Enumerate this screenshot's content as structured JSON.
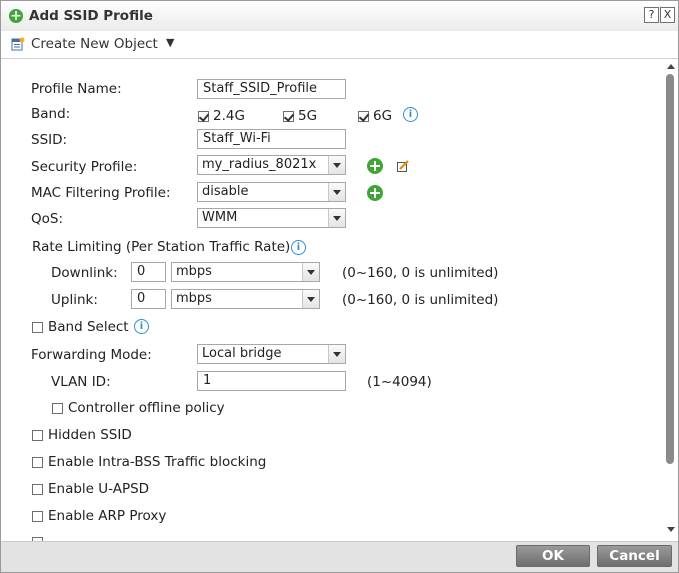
{
  "dialog": {
    "title": "Add SSID Profile",
    "help_label": "?",
    "close_label": "X"
  },
  "toolbar": {
    "create_label": "Create New Object",
    "caret": "▼"
  },
  "form": {
    "profile_name": {
      "label": "Profile Name:",
      "value": "Staff_SSID_Profile"
    },
    "band": {
      "label": "Band:",
      "options": [
        {
          "label": "2.4G",
          "checked": true
        },
        {
          "label": "5G",
          "checked": true
        },
        {
          "label": "6G",
          "checked": true
        }
      ]
    },
    "ssid": {
      "label": "SSID:",
      "value": "Staff_Wi-Fi"
    },
    "security_profile": {
      "label": "Security Profile:",
      "value": "my_radius_8021x"
    },
    "mac_filtering": {
      "label": "MAC Filtering Profile:",
      "value": "disable"
    },
    "qos": {
      "label": "QoS:",
      "value": "WMM"
    },
    "rate_limiting": {
      "label": "Rate Limiting (Per Station Traffic Rate)",
      "downlink": {
        "label": "Downlink:",
        "value": "0",
        "unit": "mbps",
        "hint": "(0~160, 0 is unlimited)"
      },
      "uplink": {
        "label": "Uplink:",
        "value": "0",
        "unit": "mbps",
        "hint": "(0~160, 0 is unlimited)"
      }
    },
    "band_select": {
      "label": "Band Select",
      "checked": false
    },
    "forwarding_mode": {
      "label": "Forwarding Mode:",
      "value": "Local bridge"
    },
    "vlan_id": {
      "label": "VLAN ID:",
      "value": "1",
      "hint": "(1~4094)"
    },
    "controller_offline": {
      "label": "Controller offline policy",
      "checked": false
    },
    "hidden_ssid": {
      "label": "Hidden SSID",
      "checked": false
    },
    "intra_bss": {
      "label": "Enable Intra-BSS Traffic blocking",
      "checked": false
    },
    "u_apsd": {
      "label": "Enable U-APSD",
      "checked": false
    },
    "arp_proxy": {
      "label": "Enable ARP Proxy",
      "checked": false
    }
  },
  "footer": {
    "ok_label": "OK",
    "cancel_label": "Cancel"
  },
  "icons": {
    "title_add": "plus-circle-icon",
    "create_object": "new-object-icon",
    "info": "info-icon",
    "add": "plus-circle-icon",
    "edit": "edit-icon"
  },
  "colors": {
    "accent_green": "#3fa535",
    "info_blue": "#2a8fd6",
    "button_gray": "#7c7c7c"
  }
}
